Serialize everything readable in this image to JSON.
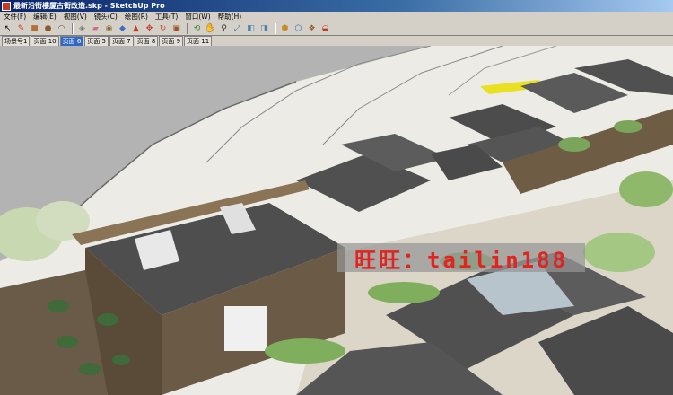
{
  "window": {
    "title": "最新沿街樓厦古街改造.skp - SketchUp Pro"
  },
  "menu": {
    "items": [
      {
        "label": "文件(F)"
      },
      {
        "label": "编辑(E)"
      },
      {
        "label": "视图(V)"
      },
      {
        "label": "镜头(C)"
      },
      {
        "label": "绘图(R)"
      },
      {
        "label": "工具(T)"
      },
      {
        "label": "窗口(W)"
      },
      {
        "label": "帮助(H)"
      }
    ]
  },
  "toolbar": {
    "tools": [
      {
        "icon": "select-arrow-icon",
        "glyph": "↖",
        "color": "#000000"
      },
      {
        "icon": "pencil-icon",
        "glyph": "✎",
        "color": "#c0392b"
      },
      {
        "icon": "rectangle-icon",
        "glyph": "■",
        "color": "#b0723a"
      },
      {
        "icon": "circle-icon",
        "glyph": "●",
        "color": "#8a5a2b"
      },
      {
        "icon": "arc-icon",
        "glyph": "◠",
        "color": "#555555"
      },
      {
        "icon": "make-component-icon",
        "glyph": "◈",
        "color": "#7a7a7a"
      },
      {
        "icon": "eraser-icon",
        "glyph": "▰",
        "color": "#d46a8a"
      },
      {
        "icon": "tape-measure-icon",
        "glyph": "◉",
        "color": "#8a6d2f"
      },
      {
        "icon": "paint-bucket-icon",
        "glyph": "◆",
        "color": "#3a6fbf"
      },
      {
        "icon": "push-pull-icon",
        "glyph": "▲",
        "color": "#c23b22"
      },
      {
        "icon": "move-icon",
        "glyph": "✥",
        "color": "#c0392b"
      },
      {
        "icon": "rotate-icon",
        "glyph": "↻",
        "color": "#c0392b"
      },
      {
        "icon": "offset-icon",
        "glyph": "▣",
        "color": "#a0522d"
      },
      {
        "icon": "orbit-icon",
        "glyph": "⟲",
        "color": "#2e7d32"
      },
      {
        "icon": "pan-icon",
        "glyph": "✋",
        "color": "#ffffff"
      },
      {
        "icon": "zoom-icon",
        "glyph": "⚲",
        "color": "#333333"
      },
      {
        "icon": "zoom-extents-icon",
        "glyph": "⤢",
        "color": "#1f5fa8"
      },
      {
        "icon": "previous-view-icon",
        "glyph": "◧",
        "color": "#4a7fb5"
      },
      {
        "icon": "next-view-icon",
        "glyph": "◨",
        "color": "#4a7fb5"
      },
      {
        "icon": "get-models-icon",
        "glyph": "⬢",
        "color": "#c68a2e"
      },
      {
        "icon": "share-model-icon",
        "glyph": "⬡",
        "color": "#2e6fc6"
      },
      {
        "icon": "components-icon",
        "glyph": "❖",
        "color": "#8a5a2b"
      },
      {
        "icon": "extension-warehouse-icon",
        "glyph": "◒",
        "color": "#c23b22"
      }
    ]
  },
  "scenes": [
    {
      "label": "场景号1",
      "active": false
    },
    {
      "label": "页面 10",
      "active": false
    },
    {
      "label": "页面 6",
      "active": true
    },
    {
      "label": "页面 5",
      "active": false
    },
    {
      "label": "页面 7",
      "active": false
    },
    {
      "label": "页面 8",
      "active": false
    },
    {
      "label": "页面 9",
      "active": false
    },
    {
      "label": "页面 11",
      "active": false
    }
  ],
  "viewport": {
    "watermark_text": "旺旺：tailin188",
    "colors": {
      "water": "#b3b3b3",
      "roof": "#555555",
      "ground": "#dcd6c8",
      "tree": "#8fb86a",
      "highlight": "#e8e021",
      "watermark": "#e0241f"
    }
  }
}
